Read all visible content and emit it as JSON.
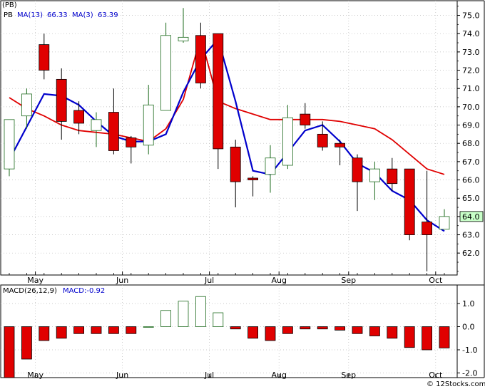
{
  "chart_data": [
    {
      "type": "candlestick",
      "legend": {
        "ticker": "PB",
        "title": "(PB)",
        "ma13_label": "MA(13)",
        "ma13_value": "66.33",
        "ma3_label": "MA(3)",
        "ma3_value": "63.39"
      },
      "colors": {
        "up": "#ffffff",
        "up_border": "#1e6b1e",
        "down": "#e00000",
        "ma13": "#e00000",
        "ma3": "#0000cc",
        "grid": "#b8b8b8",
        "last_price_bg": "#c8ffc8"
      },
      "y_ticks": [
        "62.0",
        "63.0",
        "64.0",
        "65.0",
        "66.0",
        "67.0",
        "68.0",
        "69.0",
        "70.0",
        "71.0",
        "72.0",
        "73.0",
        "74.0",
        "75.0"
      ],
      "ylim": [
        60.8,
        75.8
      ],
      "x_months": [
        {
          "label": "May",
          "week": 1.5
        },
        {
          "label": "Jun",
          "week": 6.5
        },
        {
          "label": "Jul",
          "week": 11.5
        },
        {
          "label": "Aug",
          "week": 15.5
        },
        {
          "label": "Sep",
          "week": 19.5
        },
        {
          "label": "Oct",
          "week": 24.5
        }
      ],
      "last_price": "64.0",
      "candles": [
        {
          "o": 66.6,
          "h": 69.3,
          "l": 66.2,
          "c": 69.3
        },
        {
          "o": 69.5,
          "h": 71.0,
          "l": 68.8,
          "c": 70.7
        },
        {
          "o": 73.4,
          "h": 74.0,
          "l": 71.5,
          "c": 72.0
        },
        {
          "o": 71.5,
          "h": 72.1,
          "l": 68.2,
          "c": 69.2
        },
        {
          "o": 69.8,
          "h": 70.3,
          "l": 68.5,
          "c": 69.1
        },
        {
          "o": 68.7,
          "h": 69.7,
          "l": 67.8,
          "c": 69.3
        },
        {
          "o": 69.7,
          "h": 71.0,
          "l": 67.4,
          "c": 67.6
        },
        {
          "o": 68.3,
          "h": 68.4,
          "l": 66.9,
          "c": 67.8
        },
        {
          "o": 67.9,
          "h": 71.2,
          "l": 67.4,
          "c": 70.1
        },
        {
          "o": 69.8,
          "h": 74.6,
          "l": 69.8,
          "c": 73.9
        },
        {
          "o": 73.6,
          "h": 75.4,
          "l": 73.5,
          "c": 73.8
        },
        {
          "o": 73.9,
          "h": 74.6,
          "l": 71.0,
          "c": 71.3
        },
        {
          "o": 74.0,
          "h": 74.0,
          "l": 66.6,
          "c": 67.7
        },
        {
          "o": 67.8,
          "h": 68.2,
          "l": 64.5,
          "c": 65.9
        },
        {
          "o": 66.1,
          "h": 66.2,
          "l": 65.1,
          "c": 66.0
        },
        {
          "o": 66.3,
          "h": 67.9,
          "l": 65.3,
          "c": 67.2
        },
        {
          "o": 66.8,
          "h": 70.1,
          "l": 66.6,
          "c": 69.4
        },
        {
          "o": 69.6,
          "h": 70.2,
          "l": 68.8,
          "c": 69.0
        },
        {
          "o": 68.5,
          "h": 69.2,
          "l": 67.6,
          "c": 67.8
        },
        {
          "o": 68.0,
          "h": 68.2,
          "l": 66.8,
          "c": 67.8
        },
        {
          "o": 67.2,
          "h": 67.4,
          "l": 64.3,
          "c": 65.9
        },
        {
          "o": 65.9,
          "h": 67.0,
          "l": 64.9,
          "c": 66.6
        },
        {
          "o": 66.6,
          "h": 67.2,
          "l": 65.4,
          "c": 65.8
        },
        {
          "o": 66.6,
          "h": 66.6,
          "l": 62.7,
          "c": 63.0
        },
        {
          "o": 63.7,
          "h": 66.5,
          "l": 61.0,
          "c": 63.0
        },
        {
          "o": 63.3,
          "h": 64.4,
          "l": 63.3,
          "c": 64.0
        }
      ],
      "ma13": [
        {
          "week": 0,
          "v": 70.5
        },
        {
          "week": 1,
          "v": 69.9
        },
        {
          "week": 2,
          "v": 69.5
        },
        {
          "week": 3,
          "v": 69.0
        },
        {
          "week": 4,
          "v": 68.7
        },
        {
          "week": 5,
          "v": 68.6
        },
        {
          "week": 6,
          "v": 68.5
        },
        {
          "week": 7,
          "v": 68.3
        },
        {
          "week": 8,
          "v": 68.1
        },
        {
          "week": 9,
          "v": 68.8
        },
        {
          "week": 10,
          "v": 70.4
        },
        {
          "week": 11,
          "v": 73.8
        },
        {
          "week": 12,
          "v": 70.3
        },
        {
          "week": 13,
          "v": 69.9
        },
        {
          "week": 14,
          "v": 69.6
        },
        {
          "week": 15,
          "v": 69.3
        },
        {
          "week": 16,
          "v": 69.3
        },
        {
          "week": 17,
          "v": 69.3
        },
        {
          "week": 18,
          "v": 69.3
        },
        {
          "week": 19,
          "v": 69.2
        },
        {
          "week": 20,
          "v": 69.0
        },
        {
          "week": 21,
          "v": 68.8
        },
        {
          "week": 22,
          "v": 68.2
        },
        {
          "week": 23,
          "v": 67.4
        },
        {
          "week": 24,
          "v": 66.6
        },
        {
          "week": 25,
          "v": 66.3
        }
      ],
      "ma3": [
        {
          "week": 0,
          "v": 67.1
        },
        {
          "week": 1,
          "v": 68.9
        },
        {
          "week": 2,
          "v": 70.7
        },
        {
          "week": 3,
          "v": 70.6
        },
        {
          "week": 4,
          "v": 70.1
        },
        {
          "week": 5,
          "v": 69.2
        },
        {
          "week": 6,
          "v": 68.4
        },
        {
          "week": 7,
          "v": 68.1
        },
        {
          "week": 8,
          "v": 68.1
        },
        {
          "week": 9,
          "v": 68.5
        },
        {
          "week": 10,
          "v": 70.8
        },
        {
          "week": 11,
          "v": 72.6
        },
        {
          "week": 12,
          "v": 73.7
        },
        {
          "week": 13,
          "v": 70.3
        },
        {
          "week": 14,
          "v": 66.5
        },
        {
          "week": 15,
          "v": 66.3
        },
        {
          "week": 16,
          "v": 67.5
        },
        {
          "week": 17,
          "v": 68.7
        },
        {
          "week": 18,
          "v": 69.0
        },
        {
          "week": 19,
          "v": 68.1
        },
        {
          "week": 20,
          "v": 66.9
        },
        {
          "week": 21,
          "v": 66.4
        },
        {
          "week": 22,
          "v": 65.4
        },
        {
          "week": 23,
          "v": 64.9
        },
        {
          "week": 24,
          "v": 63.8
        },
        {
          "week": 25,
          "v": 63.2
        }
      ]
    },
    {
      "type": "bar",
      "legend": {
        "title": "MACD(26,12,9)",
        "value_label": "MACD:-0.92"
      },
      "y_ticks": [
        "1.0",
        "0.0",
        "-1.0",
        "-2.0"
      ],
      "ylim": [
        -2.2,
        1.8
      ],
      "values": [
        -2.2,
        -1.4,
        -0.6,
        -0.5,
        -0.3,
        -0.3,
        -0.3,
        -0.3,
        0.0,
        0.7,
        1.1,
        1.3,
        0.6,
        -0.1,
        -0.5,
        -0.6,
        -0.3,
        -0.1,
        -0.1,
        -0.15,
        -0.3,
        -0.4,
        -0.5,
        -0.9,
        -1.0,
        -0.92
      ],
      "x_months": [
        "May",
        "Jun",
        "Jul",
        "Aug",
        "Sep",
        "Oct"
      ]
    }
  ],
  "footer": {
    "copyright": "© 12Stocks.com"
  }
}
